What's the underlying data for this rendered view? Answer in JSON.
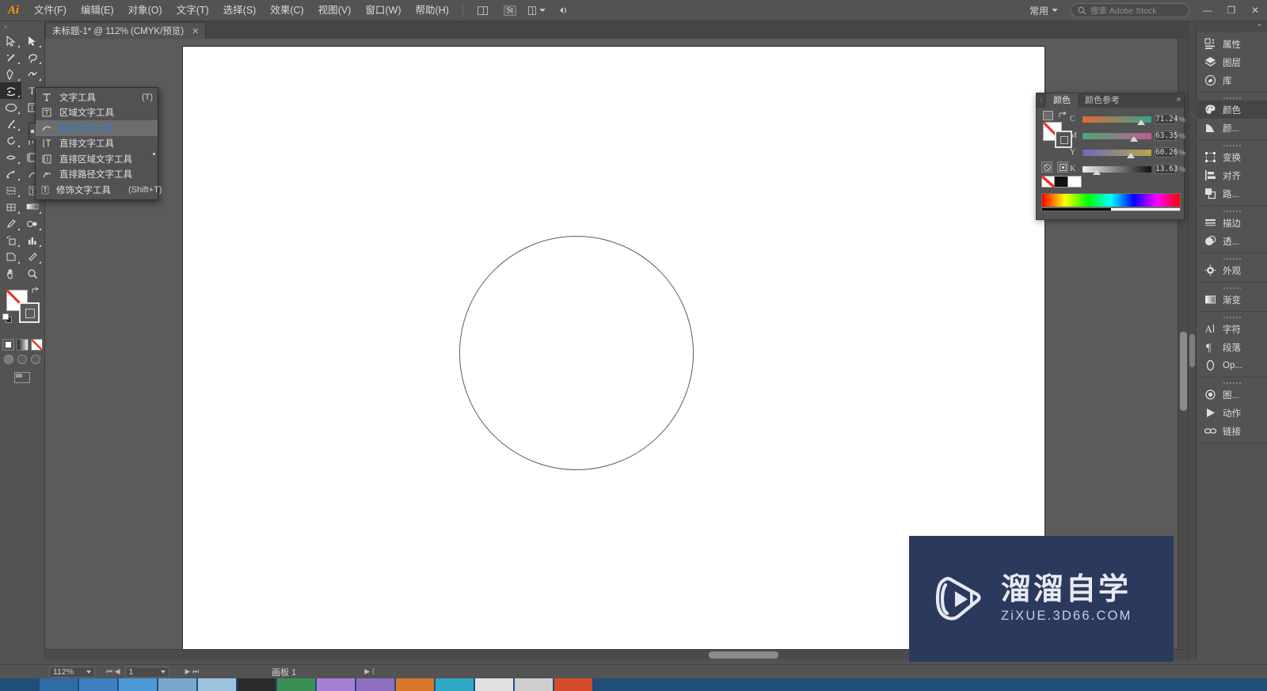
{
  "app": {
    "logo": "Ai",
    "workspace": "常用",
    "search_placeholder": "搜索 Adobe Stock"
  },
  "menubar": {
    "items": [
      {
        "label": "文件(F)"
      },
      {
        "label": "编辑(E)"
      },
      {
        "label": "对象(O)"
      },
      {
        "label": "文字(T)"
      },
      {
        "label": "选择(S)"
      },
      {
        "label": "效果(C)"
      },
      {
        "label": "视图(V)"
      },
      {
        "label": "窗口(W)"
      },
      {
        "label": "帮助(H)"
      }
    ],
    "stock_badge": "St",
    "minimize": "—",
    "restore": "❐",
    "close": "✕"
  },
  "tab": {
    "title": "未标题-1* @ 112% (CMYK/预览)",
    "close": "✕"
  },
  "flyout": {
    "items": [
      {
        "label": "文字工具",
        "shortcut": "(T)",
        "icon": "type-tool-icon",
        "selected": false
      },
      {
        "label": "区域文字工具",
        "shortcut": "",
        "icon": "area-type-tool-icon",
        "selected": false
      },
      {
        "label": "路径文字工具",
        "shortcut": "",
        "icon": "type-on-path-tool-icon",
        "selected": true
      },
      {
        "label": "直排文字工具",
        "shortcut": "",
        "icon": "vertical-type-tool-icon",
        "selected": false
      },
      {
        "label": "直排区域文字工具",
        "shortcut": "",
        "icon": "vertical-area-type-tool-icon",
        "selected": false
      },
      {
        "label": "直排路径文字工具",
        "shortcut": "",
        "icon": "vertical-type-on-path-tool-icon",
        "selected": false
      },
      {
        "label": "修饰文字工具",
        "shortcut": "(Shift+T)",
        "icon": "touch-type-tool-icon",
        "selected": false
      }
    ]
  },
  "toolbar": {
    "tools": [
      {
        "name": "selection-tool",
        "row": 0,
        "col": 0
      },
      {
        "name": "direct-selection-tool",
        "row": 0,
        "col": 1
      },
      {
        "name": "magic-wand-tool",
        "row": 1,
        "col": 0
      },
      {
        "name": "lasso-tool",
        "row": 1,
        "col": 1
      },
      {
        "name": "pen-tool",
        "row": 2,
        "col": 0
      },
      {
        "name": "curvature-tool",
        "row": 2,
        "col": 1
      },
      {
        "name": "type-tool",
        "row": 3,
        "col": 0
      },
      {
        "name": "line-segment-tool",
        "row": 3,
        "col": 1
      },
      {
        "name": "ellipse-tool",
        "row": 4,
        "col": 0
      },
      {
        "name": "paintbrush-tool",
        "row": 4,
        "col": 1
      },
      {
        "name": "shaper-tool",
        "row": 5,
        "col": 0
      },
      {
        "name": "pencil-tool",
        "row": 5,
        "col": 1
      },
      {
        "name": "rotate-tool",
        "row": 6,
        "col": 0
      },
      {
        "name": "scale-tool",
        "row": 6,
        "col": 1
      },
      {
        "name": "width-tool",
        "row": 7,
        "col": 0
      },
      {
        "name": "free-transform-tool",
        "row": 7,
        "col": 1
      },
      {
        "name": "shape-builder-tool",
        "row": 8,
        "col": 0
      },
      {
        "name": "perspective-grid-tool",
        "row": 8,
        "col": 1
      },
      {
        "name": "mesh-tool",
        "row": 9,
        "col": 0
      },
      {
        "name": "gradient-tool",
        "row": 9,
        "col": 1
      },
      {
        "name": "eyedropper-tool",
        "row": 10,
        "col": 0
      },
      {
        "name": "blend-tool",
        "row": 10,
        "col": 1
      },
      {
        "name": "symbol-sprayer-tool",
        "row": 11,
        "col": 0
      },
      {
        "name": "column-graph-tool",
        "row": 11,
        "col": 1
      },
      {
        "name": "artboard-tool",
        "row": 12,
        "col": 0
      },
      {
        "name": "slice-tool",
        "row": 12,
        "col": 1
      },
      {
        "name": "hand-tool",
        "row": 13,
        "col": 0
      },
      {
        "name": "zoom-tool",
        "row": 13,
        "col": 1
      }
    ],
    "active_tool": "type-tool"
  },
  "color_panel": {
    "tabs": [
      {
        "label": "颜色",
        "active": true
      },
      {
        "label": "颜色参考",
        "active": false
      }
    ],
    "sliders": [
      {
        "label": "C",
        "value": "71.24",
        "unit": "%",
        "pos": 74
      },
      {
        "label": "M",
        "value": "63.35",
        "unit": "%",
        "pos": 66
      },
      {
        "label": "Y",
        "value": "60.26",
        "unit": "%",
        "pos": 63
      },
      {
        "label": "K",
        "value": "13.63",
        "unit": "%",
        "pos": 15
      }
    ]
  },
  "right_dock": {
    "groups": [
      {
        "items": [
          {
            "label": "属性",
            "icon": "properties-icon",
            "active": false
          },
          {
            "label": "图层",
            "icon": "layers-icon",
            "active": false
          },
          {
            "label": "库",
            "icon": "libraries-icon",
            "active": false
          }
        ]
      },
      {
        "items": [
          {
            "label": "颜色",
            "icon": "color-palette-icon",
            "active": true
          },
          {
            "label": "颜...",
            "icon": "color-guide-icon",
            "active": false
          }
        ]
      },
      {
        "items": [
          {
            "label": "变换",
            "icon": "transform-icon",
            "active": false
          },
          {
            "label": "对齐",
            "icon": "align-icon",
            "active": false
          },
          {
            "label": "路...",
            "icon": "pathfinder-icon",
            "active": false
          }
        ]
      },
      {
        "items": [
          {
            "label": "描边",
            "icon": "stroke-icon",
            "active": false
          },
          {
            "label": "透...",
            "icon": "transparency-icon",
            "active": false
          }
        ]
      },
      {
        "items": [
          {
            "label": "外观",
            "icon": "appearance-icon",
            "active": false
          }
        ]
      },
      {
        "items": [
          {
            "label": "渐变",
            "icon": "gradient-icon",
            "active": false
          }
        ]
      },
      {
        "items": [
          {
            "label": "字符",
            "icon": "character-icon",
            "active": false
          },
          {
            "label": "段落",
            "icon": "paragraph-icon",
            "active": false
          },
          {
            "label": "Op...",
            "icon": "opentype-icon",
            "active": false
          }
        ]
      },
      {
        "items": [
          {
            "label": "图...",
            "icon": "image-trace-icon",
            "active": false
          },
          {
            "label": "动作",
            "icon": "actions-icon",
            "active": false
          },
          {
            "label": "链接",
            "icon": "links-icon",
            "active": false
          }
        ]
      }
    ]
  },
  "statusbar": {
    "zoom": "112%",
    "page": "1",
    "artboard_label": "画板 1"
  },
  "watermark": {
    "cn": "溜溜自学",
    "en": "ZiXUE.3D66.COM"
  },
  "colors": {
    "chrome": "#535353",
    "canvas": "#5b5b5b",
    "accent_blue": "#2f7fd6",
    "ai_orange": "#ff9a00",
    "watermark_bg": "#2b3a5c"
  }
}
